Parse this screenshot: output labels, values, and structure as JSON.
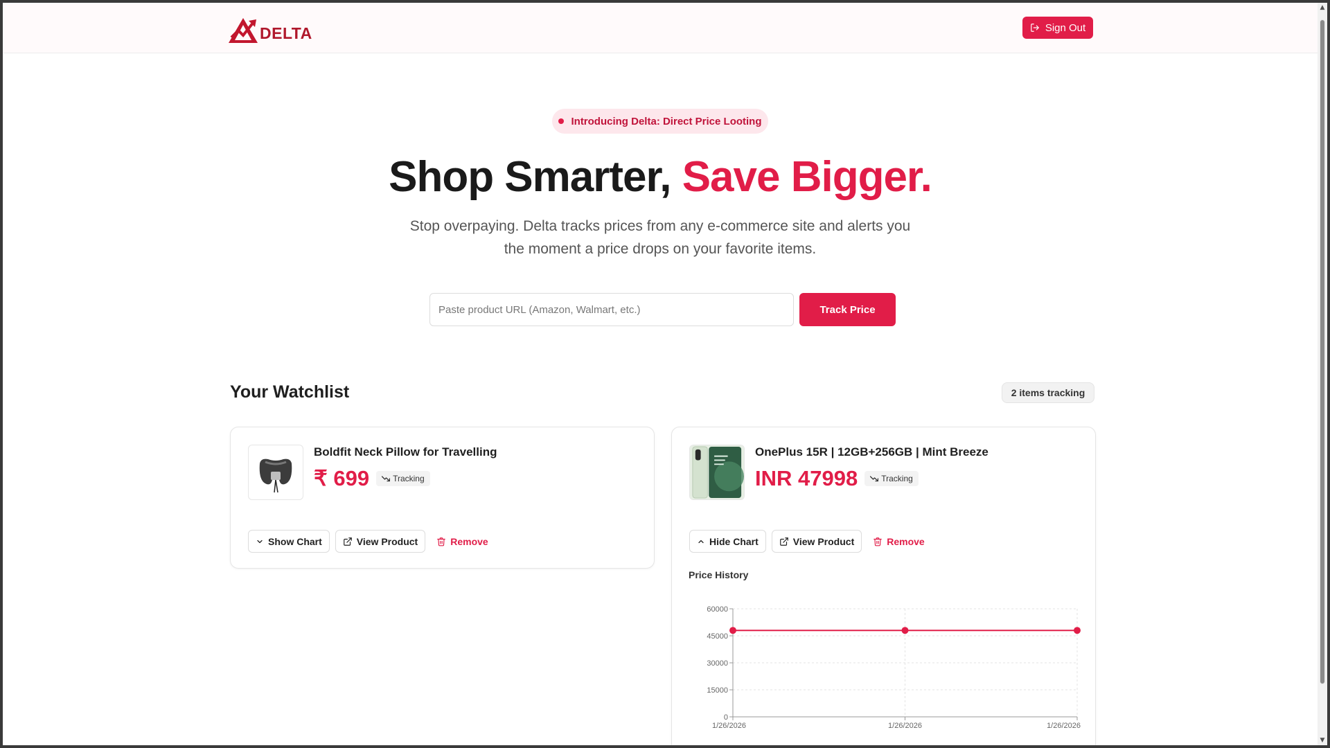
{
  "header": {
    "logo_text": "DELTA",
    "signout_label": "Sign Out"
  },
  "hero": {
    "badge": "Introducing Delta: Direct Price Looting",
    "title_main": "Shop Smarter, ",
    "title_accent": "Save Bigger.",
    "subtitle": "Stop overpaying. Delta tracks prices from any e-commerce site and alerts you the moment a price drops on your favorite items.",
    "url_placeholder": "Paste product URL (Amazon, Walmart, etc.)",
    "url_value": "",
    "track_label": "Track Price"
  },
  "watchlist": {
    "title": "Your Watchlist",
    "count_label": "2 items tracking",
    "items": [
      {
        "name": "Boldfit Neck Pillow for Travelling",
        "price": "₹ 699",
        "status": "Tracking",
        "toggle_label": "Show Chart",
        "view_label": "View Product",
        "remove_label": "Remove",
        "thumb_icon": "neck-pillow-image"
      },
      {
        "name": "OnePlus 15R | 12GB+256GB | Mint Breeze",
        "price": "INR 47998",
        "status": "Tracking",
        "toggle_label": "Hide Chart",
        "view_label": "View Product",
        "remove_label": "Remove",
        "thumb_icon": "phone-image",
        "chart_title": "Price History"
      }
    ]
  },
  "colors": {
    "accent": "#e11d48",
    "logo": "#b0182c"
  },
  "chart_data": {
    "type": "line",
    "title": "Price History",
    "x": [
      "1/26/2026",
      "1/26/2026",
      "1/26/2026"
    ],
    "series": [
      {
        "values": [
          47998,
          47998,
          47998
        ]
      }
    ],
    "ylim": [
      0,
      60000
    ],
    "yticks": [
      0,
      15000,
      30000,
      45000,
      60000
    ],
    "xlabel": "",
    "ylabel": "",
    "grid": true
  }
}
